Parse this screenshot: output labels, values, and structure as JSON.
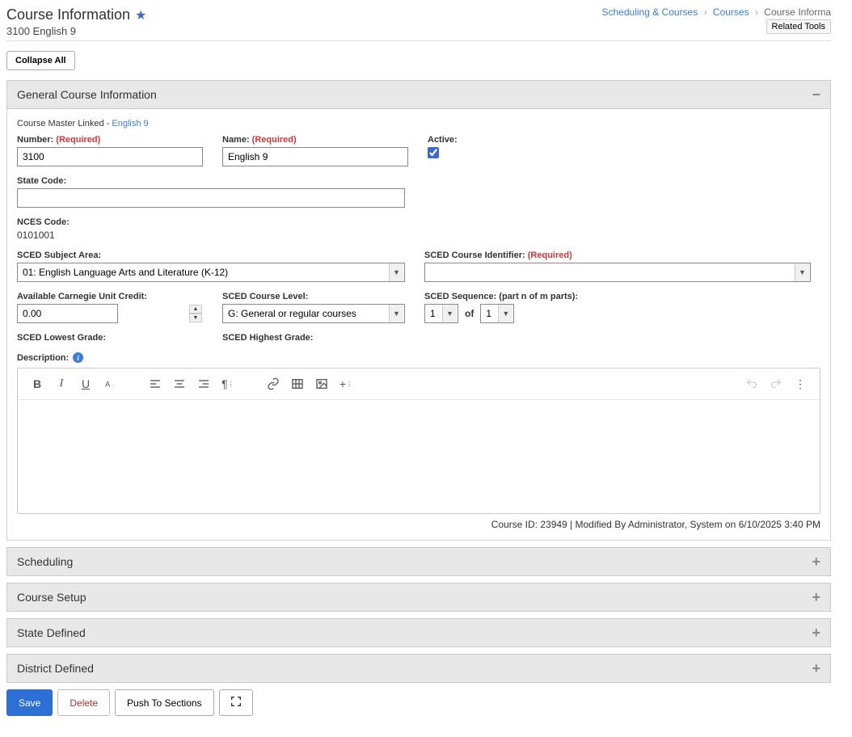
{
  "header": {
    "title": "Course Information",
    "subtitle": "3100 English 9"
  },
  "breadcrumb": {
    "item1": "Scheduling & Courses",
    "item2": "Courses",
    "item3": "Course Informa"
  },
  "related_tools_label": "Related Tools",
  "collapse_all_label": "Collapse All",
  "panels": {
    "general": "General Course Information",
    "scheduling": "Scheduling",
    "course_setup": "Course Setup",
    "state_defined": "State Defined",
    "district_defined": "District Defined"
  },
  "linked": {
    "prefix": "Course Master Linked - ",
    "link": "English 9"
  },
  "labels": {
    "number": "Number:",
    "name": "Name:",
    "active": "Active:",
    "state_code": "State Code:",
    "nces_code": "NCES Code:",
    "sced_subject": "SCED Subject Area:",
    "sced_identifier": "SCED Course Identifier:",
    "carnegie": "Available Carnegie Unit Credit:",
    "sced_level": "SCED Course Level:",
    "sced_sequence": "SCED Sequence: (part n of m parts):",
    "sced_lowest": "SCED Lowest Grade:",
    "sced_highest": "SCED Highest Grade:",
    "description": "Description:",
    "required": " (Required)",
    "of": "of"
  },
  "values": {
    "number": "3100",
    "name": "English 9",
    "state_code": "",
    "nces_code": "0101001",
    "sced_subject": "01: English Language Arts and Literature (K-12)",
    "sced_identifier": "",
    "carnegie": "0.00",
    "sced_level": "G: General or regular courses",
    "seq_n": "1",
    "seq_m": "1",
    "active": true
  },
  "footer_meta": "Course ID: 23949 | Modified By Administrator, System on 6/10/2025 3:40 PM",
  "buttons": {
    "save": "Save",
    "delete": "Delete",
    "push": "Push To Sections"
  }
}
